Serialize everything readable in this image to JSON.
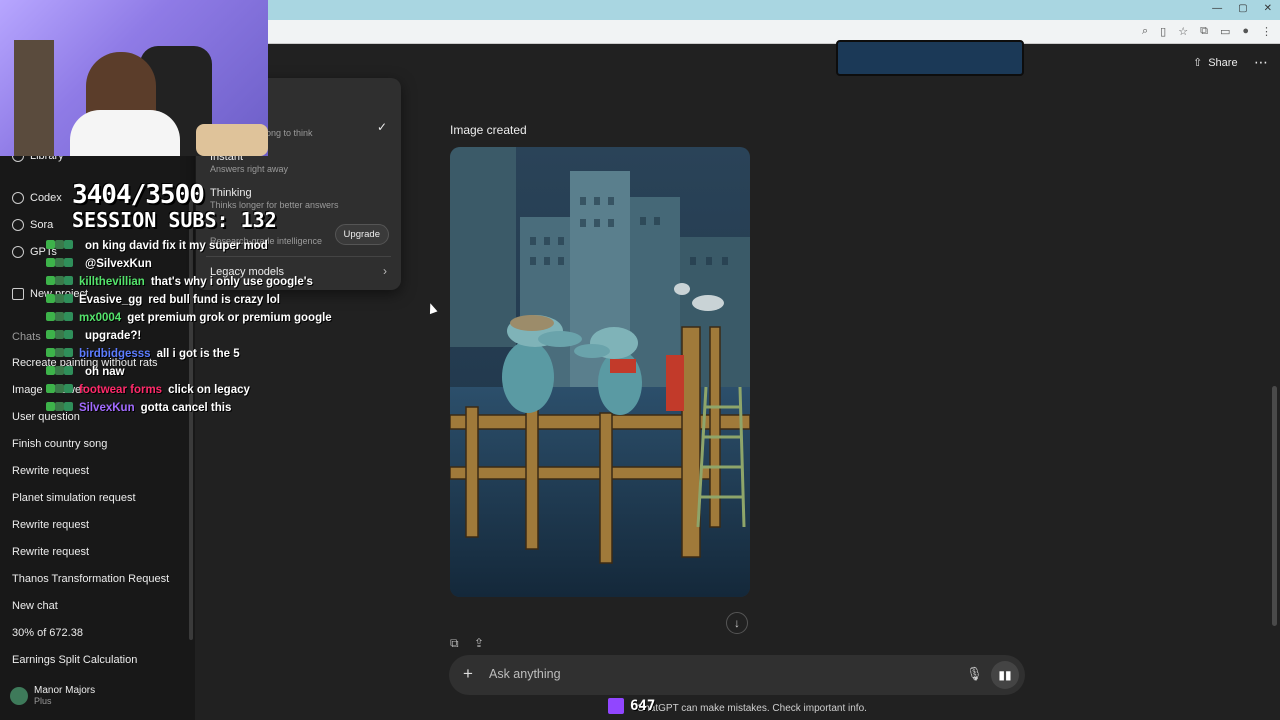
{
  "sidebar": {
    "nav": {
      "library": "Library",
      "codex": "Codex",
      "sora": "Sora",
      "gpts": "GPTs",
      "new_project": "New project"
    },
    "section_chats": "Chats",
    "chats": [
      "Recreate painting without rats",
      "Image of tower",
      "User question",
      "Finish country song",
      "Rewrite request",
      "Planet simulation request",
      "Rewrite request",
      "Rewrite request",
      "Thanos Transformation Request",
      "New chat",
      "30% of 672.38",
      "Earnings Split Calculation"
    ],
    "user": {
      "name": "Manor Majors",
      "plan": "Plus"
    }
  },
  "overlay": {
    "goal": "3404/3500",
    "session_subs": "SESSION SUBS: 132",
    "chat": [
      {
        "user": "",
        "msg": "on king david fix it my super mod",
        "color": "#4b2a90"
      },
      {
        "user": "",
        "msg": "@SilvexKun",
        "color": "#ffffff"
      },
      {
        "user": "killthevillian",
        "msg": "that's why i only use google's",
        "color": "#54e36b"
      },
      {
        "user": "Evasive_gg",
        "msg": "red bull fund is crazy lol",
        "color": "#ffffff"
      },
      {
        "user": "mx0004",
        "msg": "get premium grok or premium google",
        "color": "#54e36b"
      },
      {
        "user": "",
        "msg": "upgrade?!",
        "color": "#4b2a90"
      },
      {
        "user": "birdbidgesss",
        "msg": "all i got is the 5",
        "color": "#5c7cff"
      },
      {
        "user": "",
        "msg": "oh naw",
        "color": "#4b2a90"
      },
      {
        "user": "footwear forms",
        "msg": "click on legacy",
        "color": "#ff2a6a"
      },
      {
        "user": "SilvexKun",
        "msg": "gotta cancel this",
        "color": "#a26bff"
      }
    ],
    "viewer_count": "647"
  },
  "model_menu": {
    "auto_desc": "Decides how long to think",
    "instant_title": "Instant",
    "instant_desc": "Answers right away",
    "thinking_title": "Thinking",
    "thinking_desc": "Thinks longer for better answers",
    "pro_desc": "Research-grade intelligence",
    "upgrade_label": "Upgrade",
    "legacy_label": "Legacy models"
  },
  "header": {
    "share_label": "Share",
    "more_label": "⋯"
  },
  "main": {
    "image_label": "Image created"
  },
  "composer": {
    "placeholder": "Ask anything"
  },
  "footer": {
    "disclaimer": "ChatGPT can make mistakes. Check important info."
  }
}
